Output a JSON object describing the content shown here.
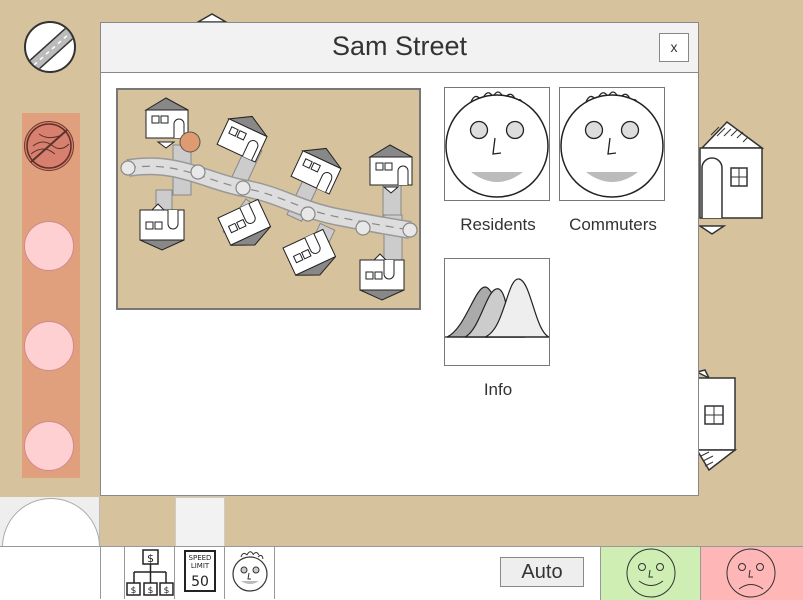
{
  "modal": {
    "title": "Sam Street",
    "close_label": "x",
    "cards": [
      {
        "label": "Residents",
        "icon": "resident-face-icon"
      },
      {
        "label": "Commuters",
        "icon": "commuter-face-icon"
      },
      {
        "label": "Info",
        "icon": "distribution-chart-icon"
      }
    ]
  },
  "toolbar": {
    "budget_icon": "budget-tree-icon",
    "speed_sign": {
      "line1": "SPEED",
      "line2": "LIMIT",
      "value": "50"
    },
    "face_icon": "citizen-face-icon",
    "auto_label": "Auto",
    "happy_icon": "happy-face-icon",
    "sad_icon": "sad-face-icon"
  },
  "colors": {
    "ground": "#d6c29c",
    "happy": "#cfeeb4",
    "sad": "#ffb6b6",
    "sidebar": "#e0a07e"
  }
}
